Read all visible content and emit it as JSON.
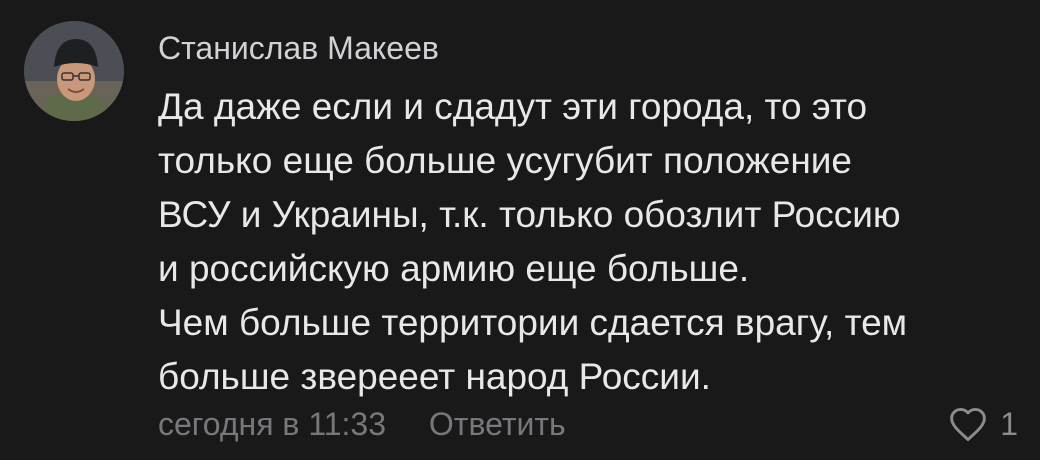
{
  "comment": {
    "author": "Станислав Макеев",
    "text_lines": [
      "Да даже если и сдадут эти города, то это",
      "только еще больше усугубит положение",
      "ВСУ и Украины, т.к. только обозлит Россию",
      "и российскую армию еще больше.",
      "Чем больше территории сдается врагу, тем",
      "больше зверееет народ России."
    ],
    "timestamp": "сегодня в 11:33",
    "reply_label": "Ответить",
    "like_count": "1"
  },
  "icons": {
    "like": "heart-outline-icon",
    "avatar": "user-photo"
  },
  "colors": {
    "background": "#19191a",
    "text": "#e7e8ea",
    "meta": "#76787c"
  }
}
